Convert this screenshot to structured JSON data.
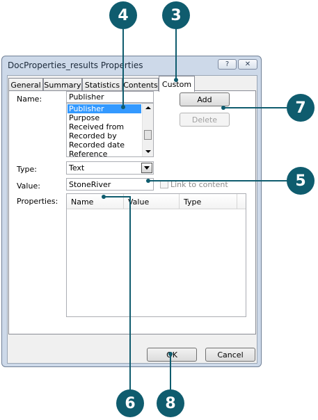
{
  "window": {
    "title": "DocProperties_results Properties",
    "help_label": "?",
    "close_label": "✕"
  },
  "tabs": [
    "General",
    "Summary",
    "Statistics",
    "Contents",
    "Custom"
  ],
  "custom": {
    "name_label": "Name:",
    "name_value": "Publisher",
    "list_items": [
      "Publisher",
      "Purpose",
      "Received from",
      "Recorded by",
      "Recorded date",
      "Reference"
    ],
    "add_label": "Add",
    "delete_label": "Delete",
    "type_label": "Type:",
    "type_value": "Text",
    "value_label": "Value:",
    "value_value": "StoneRiver",
    "link_label": "Link to content",
    "properties_label": "Properties:",
    "columns": [
      "Name",
      "Value",
      "Type"
    ]
  },
  "buttons": {
    "ok": "OK",
    "cancel": "Cancel"
  },
  "callouts": {
    "c3": "3",
    "c4": "4",
    "c5": "5",
    "c6": "6",
    "c7": "7",
    "c8": "8"
  },
  "colors": {
    "callout": "#0f5c6e",
    "selection": "#3399ff",
    "window_frame": "#cdd9e9"
  }
}
